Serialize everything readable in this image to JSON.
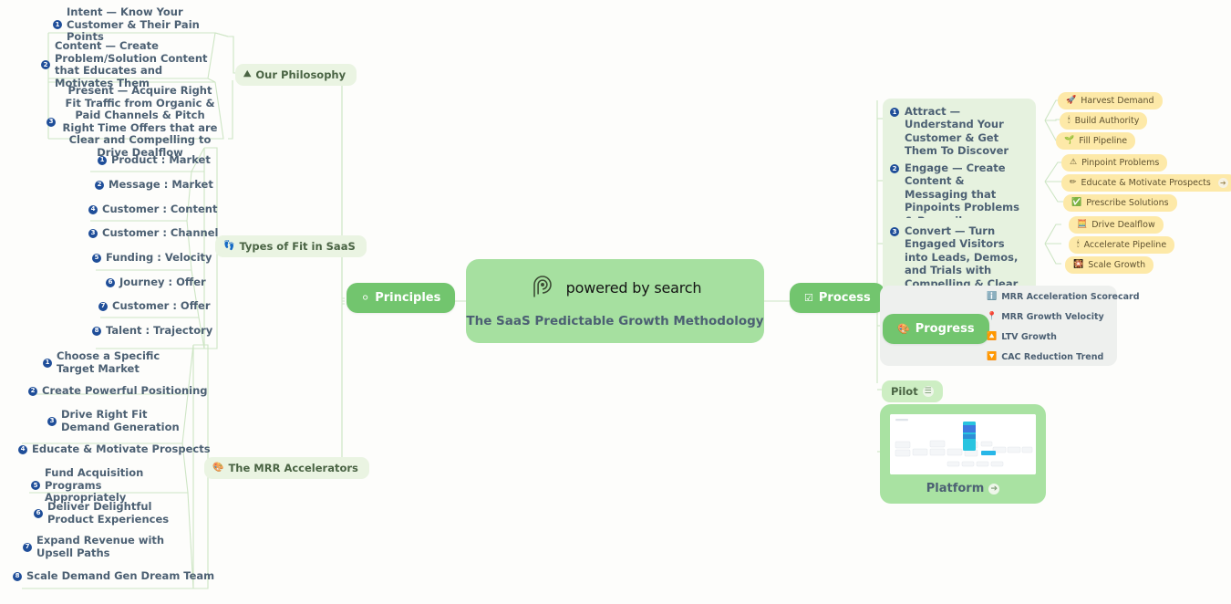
{
  "center": {
    "logo_icon": "powered-by-search-spiral-logo",
    "logo_text": "powered by search",
    "subtitle": "The SaaS Predictable Growth Methodology"
  },
  "branches": {
    "principles": {
      "label": "Principles",
      "icon": "white-dot-icon"
    },
    "process": {
      "label": "Process",
      "icon": "ballot-box-with-check-icon"
    }
  },
  "left": {
    "philosophy": {
      "label": "Our Philosophy",
      "icon": "mountain-icon",
      "items": [
        {
          "n": "1",
          "text": "Intent — Know Your Customer & Their Pain Points"
        },
        {
          "n": "2",
          "text": "Content — Create Problem/Solution Content that Educates and Motivates Them"
        },
        {
          "n": "3",
          "text": "Present — Acquire Right Fit Traffic from Organic &  Paid Channels & Pitch Right Time Offers that are Clear and Compelling to Drive Dealflow"
        }
      ]
    },
    "types_of_fit": {
      "label": "Types of Fit in SaaS",
      "icon": "footprints-icon",
      "items": [
        {
          "n": "1",
          "text": "Product : Market"
        },
        {
          "n": "2",
          "text": "Message : Market"
        },
        {
          "n": "3",
          "text": "Customer : Channel"
        },
        {
          "n": "4",
          "text": "Customer : Content"
        },
        {
          "n": "5",
          "text": "Funding : Velocity"
        },
        {
          "n": "6",
          "text": "Journey : Offer"
        },
        {
          "n": "7",
          "text": "Customer : Offer"
        },
        {
          "n": "8",
          "text": "Talent : Trajectory"
        }
      ]
    },
    "mrr_accelerators": {
      "label": "The MRR Accelerators",
      "icon": "palette-icon",
      "items": [
        {
          "n": "1",
          "text": "Choose a Specific Target Market"
        },
        {
          "n": "2",
          "text": "Create Powerful Positioning"
        },
        {
          "n": "3",
          "text": "Drive Right Fit Demand Generation"
        },
        {
          "n": "4",
          "text": "Educate & Motivate Prospects"
        },
        {
          "n": "5",
          "text": "Fund Acquisition Programs Appropriately"
        },
        {
          "n": "6",
          "text": "Deliver Delightful Product Experiences"
        },
        {
          "n": "7",
          "text": "Expand Revenue with Upsell Paths"
        },
        {
          "n": "8",
          "text": "Scale Demand Gen Dream Team"
        }
      ]
    }
  },
  "right": {
    "stages": [
      {
        "n": "1",
        "text": "Attract — Understand Your Customer & Get Them To Discover Your SaaS",
        "tags": [
          {
            "label": "Harvest Demand",
            "icon": "rocket-icon",
            "arrow": false
          },
          {
            "label": "Build Authority",
            "icon": "candle-icon",
            "arrow": false
          },
          {
            "label": "Fill Pipeline",
            "icon": "seedling-icon",
            "arrow": false
          }
        ]
      },
      {
        "n": "2",
        "text": "Engage — Create Content & Messaging that Pinpoints Problems & Prescribes Solutions",
        "tags": [
          {
            "label": "Pinpoint Problems",
            "icon": "warning-icon",
            "arrow": false
          },
          {
            "label": "Educate & Motivate Prospects",
            "icon": "pencil-icon",
            "arrow": true
          },
          {
            "label": "Prescribe Solutions",
            "icon": "check-circle-icon",
            "arrow": false
          }
        ]
      },
      {
        "n": "3",
        "text": "Convert — Turn Engaged Visitors into Leads, Demos, and Trials with Compelling & Clear Call to Actions",
        "tags": [
          {
            "label": "Drive Dealflow",
            "icon": "abacus-icon",
            "arrow": false
          },
          {
            "label": "Accelerate Pipeline",
            "icon": "candle-icon",
            "arrow": false
          },
          {
            "label": "Scale Growth",
            "icon": "sparkler-icon",
            "arrow": false
          }
        ]
      }
    ],
    "progress": {
      "label": "Progress",
      "icon": "palette-icon",
      "metrics": [
        {
          "label": "MRR Acceleration Scorecard",
          "icon": "info-icon"
        },
        {
          "label": "MRR Growth Velocity",
          "icon": "pin-icon"
        },
        {
          "label": "LTV Growth",
          "icon": "chart-up-icon"
        },
        {
          "label": "CAC Reduction Trend",
          "icon": "chart-down-icon"
        }
      ]
    },
    "pilot": {
      "label": "Pilot",
      "icon": "list-chip-icon"
    },
    "platform": {
      "label": "Platform",
      "icon": "arrow-right-chip-icon",
      "thumbnail": "mindmap-screenshot-thumbnail"
    }
  },
  "colors": {
    "node_green": "#72c56e",
    "center_green": "#a6e0a0",
    "pill_green": "#eaf4e2",
    "tag_yellow": "#fde9a8",
    "text_slate": "#4c6073",
    "badge_blue": "#1f4e99",
    "panel_grey": "#eef0ee"
  }
}
